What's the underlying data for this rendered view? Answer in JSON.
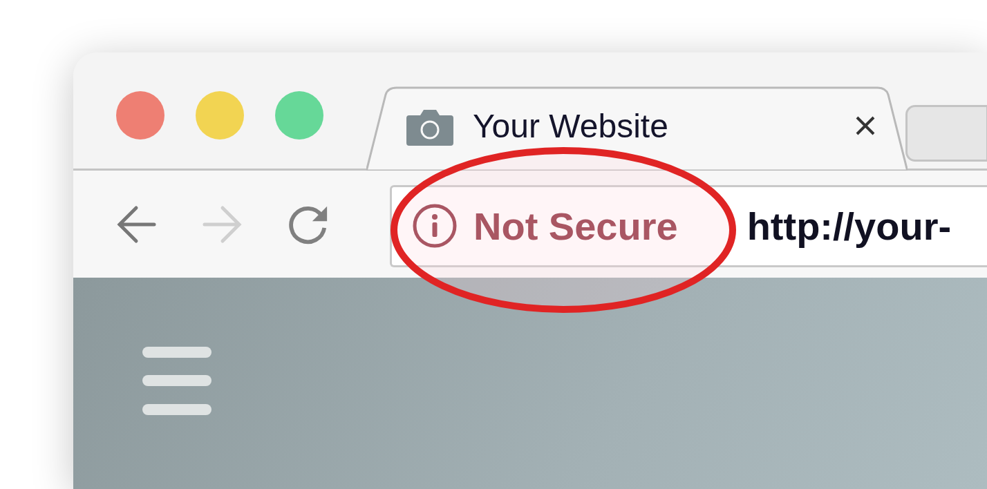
{
  "window": {
    "traffic_lights": [
      {
        "color": "#ee7f73"
      },
      {
        "color": "#f2d452"
      },
      {
        "color": "#66d898"
      }
    ]
  },
  "tabs": [
    {
      "title": "Your Website",
      "selected": true
    },
    {
      "selected": false
    }
  ],
  "toolbar": {
    "back": {
      "disabled": false
    },
    "forward": {
      "disabled": true
    },
    "reload": {
      "disabled": false
    }
  },
  "address_bar": {
    "security_label": "Not Secure",
    "url": "http://your-"
  },
  "annotation": {
    "kind": "ellipse",
    "color": "#e02424"
  }
}
